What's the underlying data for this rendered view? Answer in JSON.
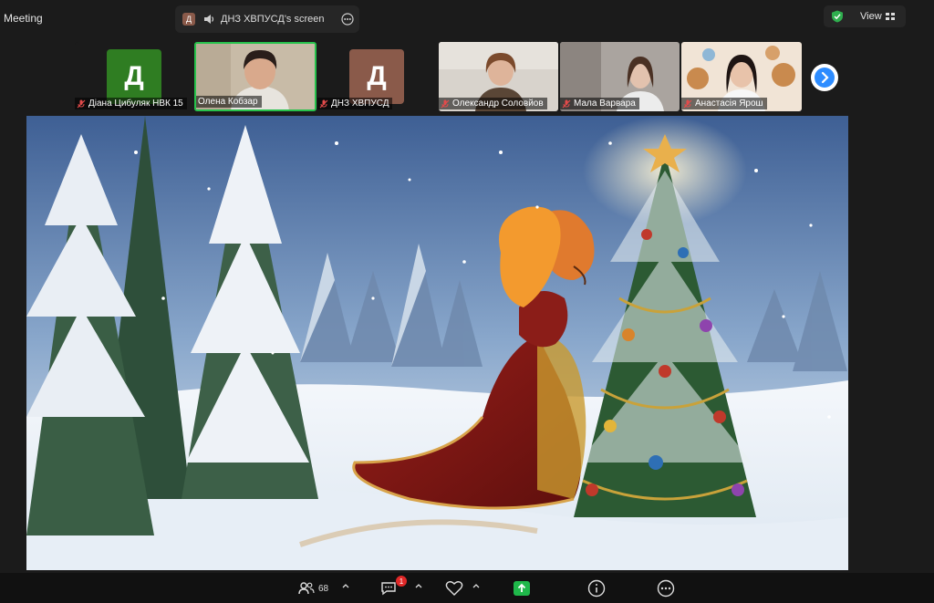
{
  "window": {
    "title": "Meeting"
  },
  "share": {
    "letter": "Д",
    "label": "ДНЗ ХВПУСД's screen"
  },
  "view": {
    "label": "View",
    "security_color": "#2fae4e"
  },
  "participants": [
    {
      "name": "Діана Цибуляк НВК 15",
      "initial": "Д",
      "color": "#2f7d22",
      "type": "avatar"
    },
    {
      "name": "Олена Кобзар",
      "initial": "",
      "color": "#b7a58e",
      "type": "video",
      "active": true
    },
    {
      "name": "ДНЗ ХВПУСД",
      "initial": "Д",
      "color": "#8a5a4a",
      "type": "avatar"
    },
    {
      "name": "Олександр Соловйов",
      "initial": "",
      "color": "#cfc9bf",
      "type": "video"
    },
    {
      "name": "Мала Варвара",
      "initial": "",
      "color": "#a8a3a0",
      "type": "video"
    },
    {
      "name": "Анастасія  Ярош",
      "initial": "",
      "color": "#e7cdb8",
      "type": "video"
    }
  ],
  "toolbar": {
    "participants_count": "68",
    "chat_badge": "1"
  },
  "colors": {
    "accent": "#2d8cff",
    "share_green": "#1fb84a",
    "active_border": "#27c24c"
  }
}
